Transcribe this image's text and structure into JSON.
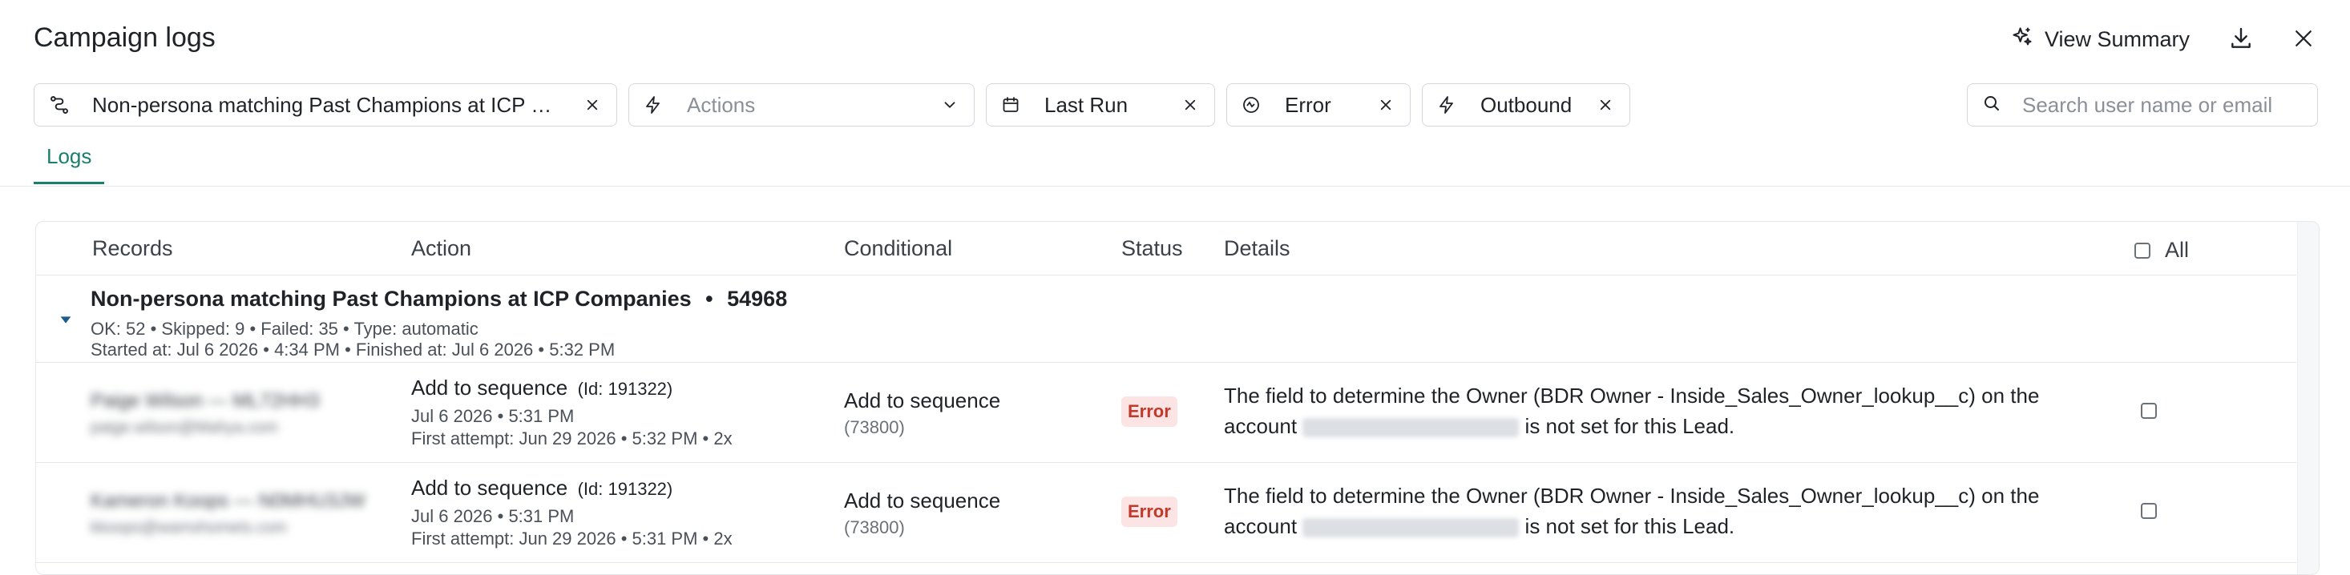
{
  "header": {
    "title": "Campaign logs",
    "view_summary_label": "View Summary"
  },
  "filters": {
    "campaign": "Non-persona matching Past Champions at ICP Co...",
    "actions_placeholder": "Actions",
    "run": "Last Run",
    "status": "Error",
    "direction": "Outbound"
  },
  "search": {
    "placeholder": "Search user name or email"
  },
  "tabs": [
    {
      "label": "Logs",
      "active": true
    }
  ],
  "table": {
    "columns": {
      "records": "Records",
      "action": "Action",
      "conditional": "Conditional",
      "status": "Status",
      "details": "Details",
      "all": "All"
    },
    "group": {
      "title": "Non-persona matching Past Champions at ICP Companies",
      "separator": "•",
      "id": "54968",
      "stats": "OK: 52 • Skipped: 9 • Failed: 35 • Type: automatic",
      "timing": "Started at: Jul 6 2026 • 4:34 PM • Finished at: Jul 6 2026 • 5:32 PM"
    },
    "rows": [
      {
        "record_name": "Paige Wilson",
        "record_id": "ML72HH3",
        "record_email": "paige.wilson@Mahya.com",
        "action": "Add to sequence",
        "action_id": "(Id: 191322)",
        "action_time": "Jul 6 2026 • 5:31 PM",
        "first_attempt": "First attempt: Jun 29 2026 • 5:32 PM • 2x",
        "conditional": "Add to sequence",
        "conditional_id": "(73800)",
        "status": "Error",
        "details_pre": "The field to determine the Owner (BDR Owner - Inside_Sales_Owner_lookup__c) on the account",
        "details_post": "is not set for this Lead."
      },
      {
        "record_name": "Kameron Koops",
        "record_id": "N0MHU3JW",
        "record_email": "kkoops@wamshomets.com",
        "action": "Add to sequence",
        "action_id": "(Id: 191322)",
        "action_time": "Jul 6 2026 • 5:31 PM",
        "first_attempt": "First attempt: Jun 29 2026 • 5:31 PM • 2x",
        "conditional": "Add to sequence",
        "conditional_id": "(73800)",
        "status": "Error",
        "details_pre": "The field to determine the Owner (BDR Owner - Inside_Sales_Owner_lookup__c) on the account",
        "details_post": "is not set for this Lead."
      }
    ]
  },
  "colors": {
    "accent": "#1b7f6e",
    "error_bg": "#fde4e4",
    "error_text": "#c0392b",
    "border": "#d4d7dc"
  }
}
